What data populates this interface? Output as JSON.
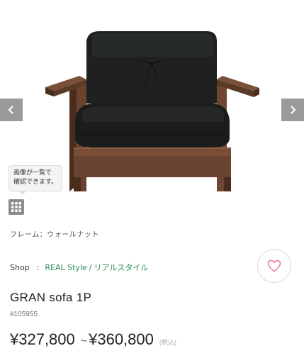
{
  "gallery": {
    "prev_icon": "chevron-left-icon",
    "next_icon": "chevron-right-icon",
    "tooltip_text": "画像が一覧で\n確認できます。",
    "grid_icon": "grid-icon"
  },
  "product": {
    "frame": "フレーム：ウォールナット",
    "title": "GRAN sofa 1P",
    "sku": "#105955",
    "price_from": "¥327,800",
    "price_tilde": "~",
    "price_to": "¥360,800",
    "tax_note": "(税込)"
  },
  "shop": {
    "label": "Shop",
    "colon": ":",
    "name_en": "REAL Style",
    "separator": "/",
    "name_ja": "リアルスタイル"
  },
  "favorite": {
    "icon": "heart-icon"
  },
  "colors": {
    "accent_green": "#2e8b57",
    "heart_pink": "#e8738f",
    "nav_gray": "#9a9a9a"
  }
}
